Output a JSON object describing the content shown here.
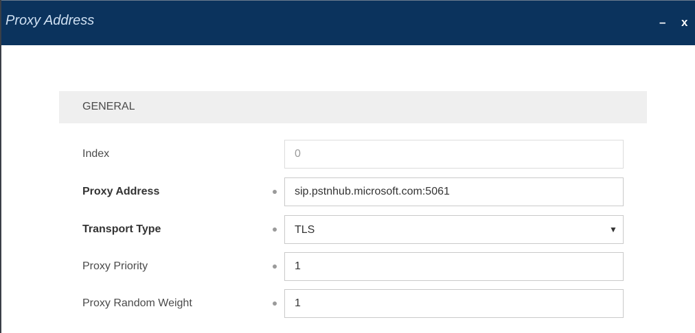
{
  "dialog": {
    "title": "Proxy Address",
    "minimize_label": "–",
    "close_label": "x"
  },
  "section": {
    "title": "GENERAL"
  },
  "fields": {
    "index": {
      "label": "Index",
      "value": "0"
    },
    "proxy_address": {
      "label": "Proxy Address",
      "value": "sip.pstnhub.microsoft.com:5061"
    },
    "transport_type": {
      "label": "Transport Type",
      "value": "TLS",
      "arrow": "▼"
    },
    "proxy_priority": {
      "label": "Proxy Priority",
      "value": "1"
    },
    "proxy_random_weight": {
      "label": "Proxy Random Weight",
      "value": "1"
    }
  },
  "colors": {
    "titlebar": "#0b335d",
    "section_header": "#efefef"
  }
}
